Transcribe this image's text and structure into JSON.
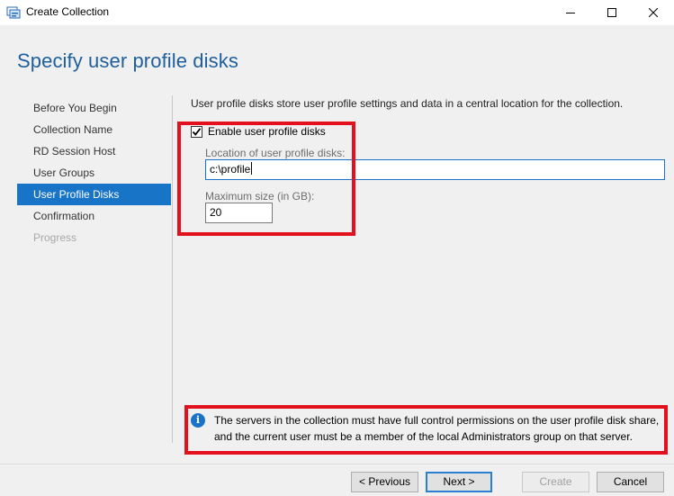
{
  "window": {
    "title": "Create Collection",
    "controls": [
      "minimize-icon",
      "maximize-icon",
      "close-icon"
    ]
  },
  "page_title": "Specify user profile disks",
  "nav": {
    "items": [
      {
        "label": "Before You Begin",
        "state": "normal"
      },
      {
        "label": "Collection Name",
        "state": "normal"
      },
      {
        "label": "RD Session Host",
        "state": "normal"
      },
      {
        "label": "User Groups",
        "state": "normal"
      },
      {
        "label": "User Profile Disks",
        "state": "selected"
      },
      {
        "label": "Confirmation",
        "state": "normal"
      },
      {
        "label": "Progress",
        "state": "disabled"
      }
    ]
  },
  "main": {
    "description": "User profile disks store user profile settings and data in a central location for the collection.",
    "enable_checkbox": {
      "label": "Enable user profile disks",
      "checked": true
    },
    "location": {
      "label": "Location of user profile disks:",
      "value": "c:\\profile"
    },
    "max_size": {
      "label": "Maximum size (in GB):",
      "value": "20"
    },
    "info": {
      "icon": "info-icon",
      "line1": "The servers in the collection must have full control permissions on the user profile disk share,",
      "line2": "and the current user must be a member of the local Administrators group on that server."
    }
  },
  "buttons": {
    "previous": "< Previous",
    "next": "Next >",
    "create": "Create",
    "cancel": "Cancel"
  },
  "colors": {
    "accent": "#1874c7",
    "title": "#1e5f9e",
    "highlight_box": "#e3101e"
  }
}
